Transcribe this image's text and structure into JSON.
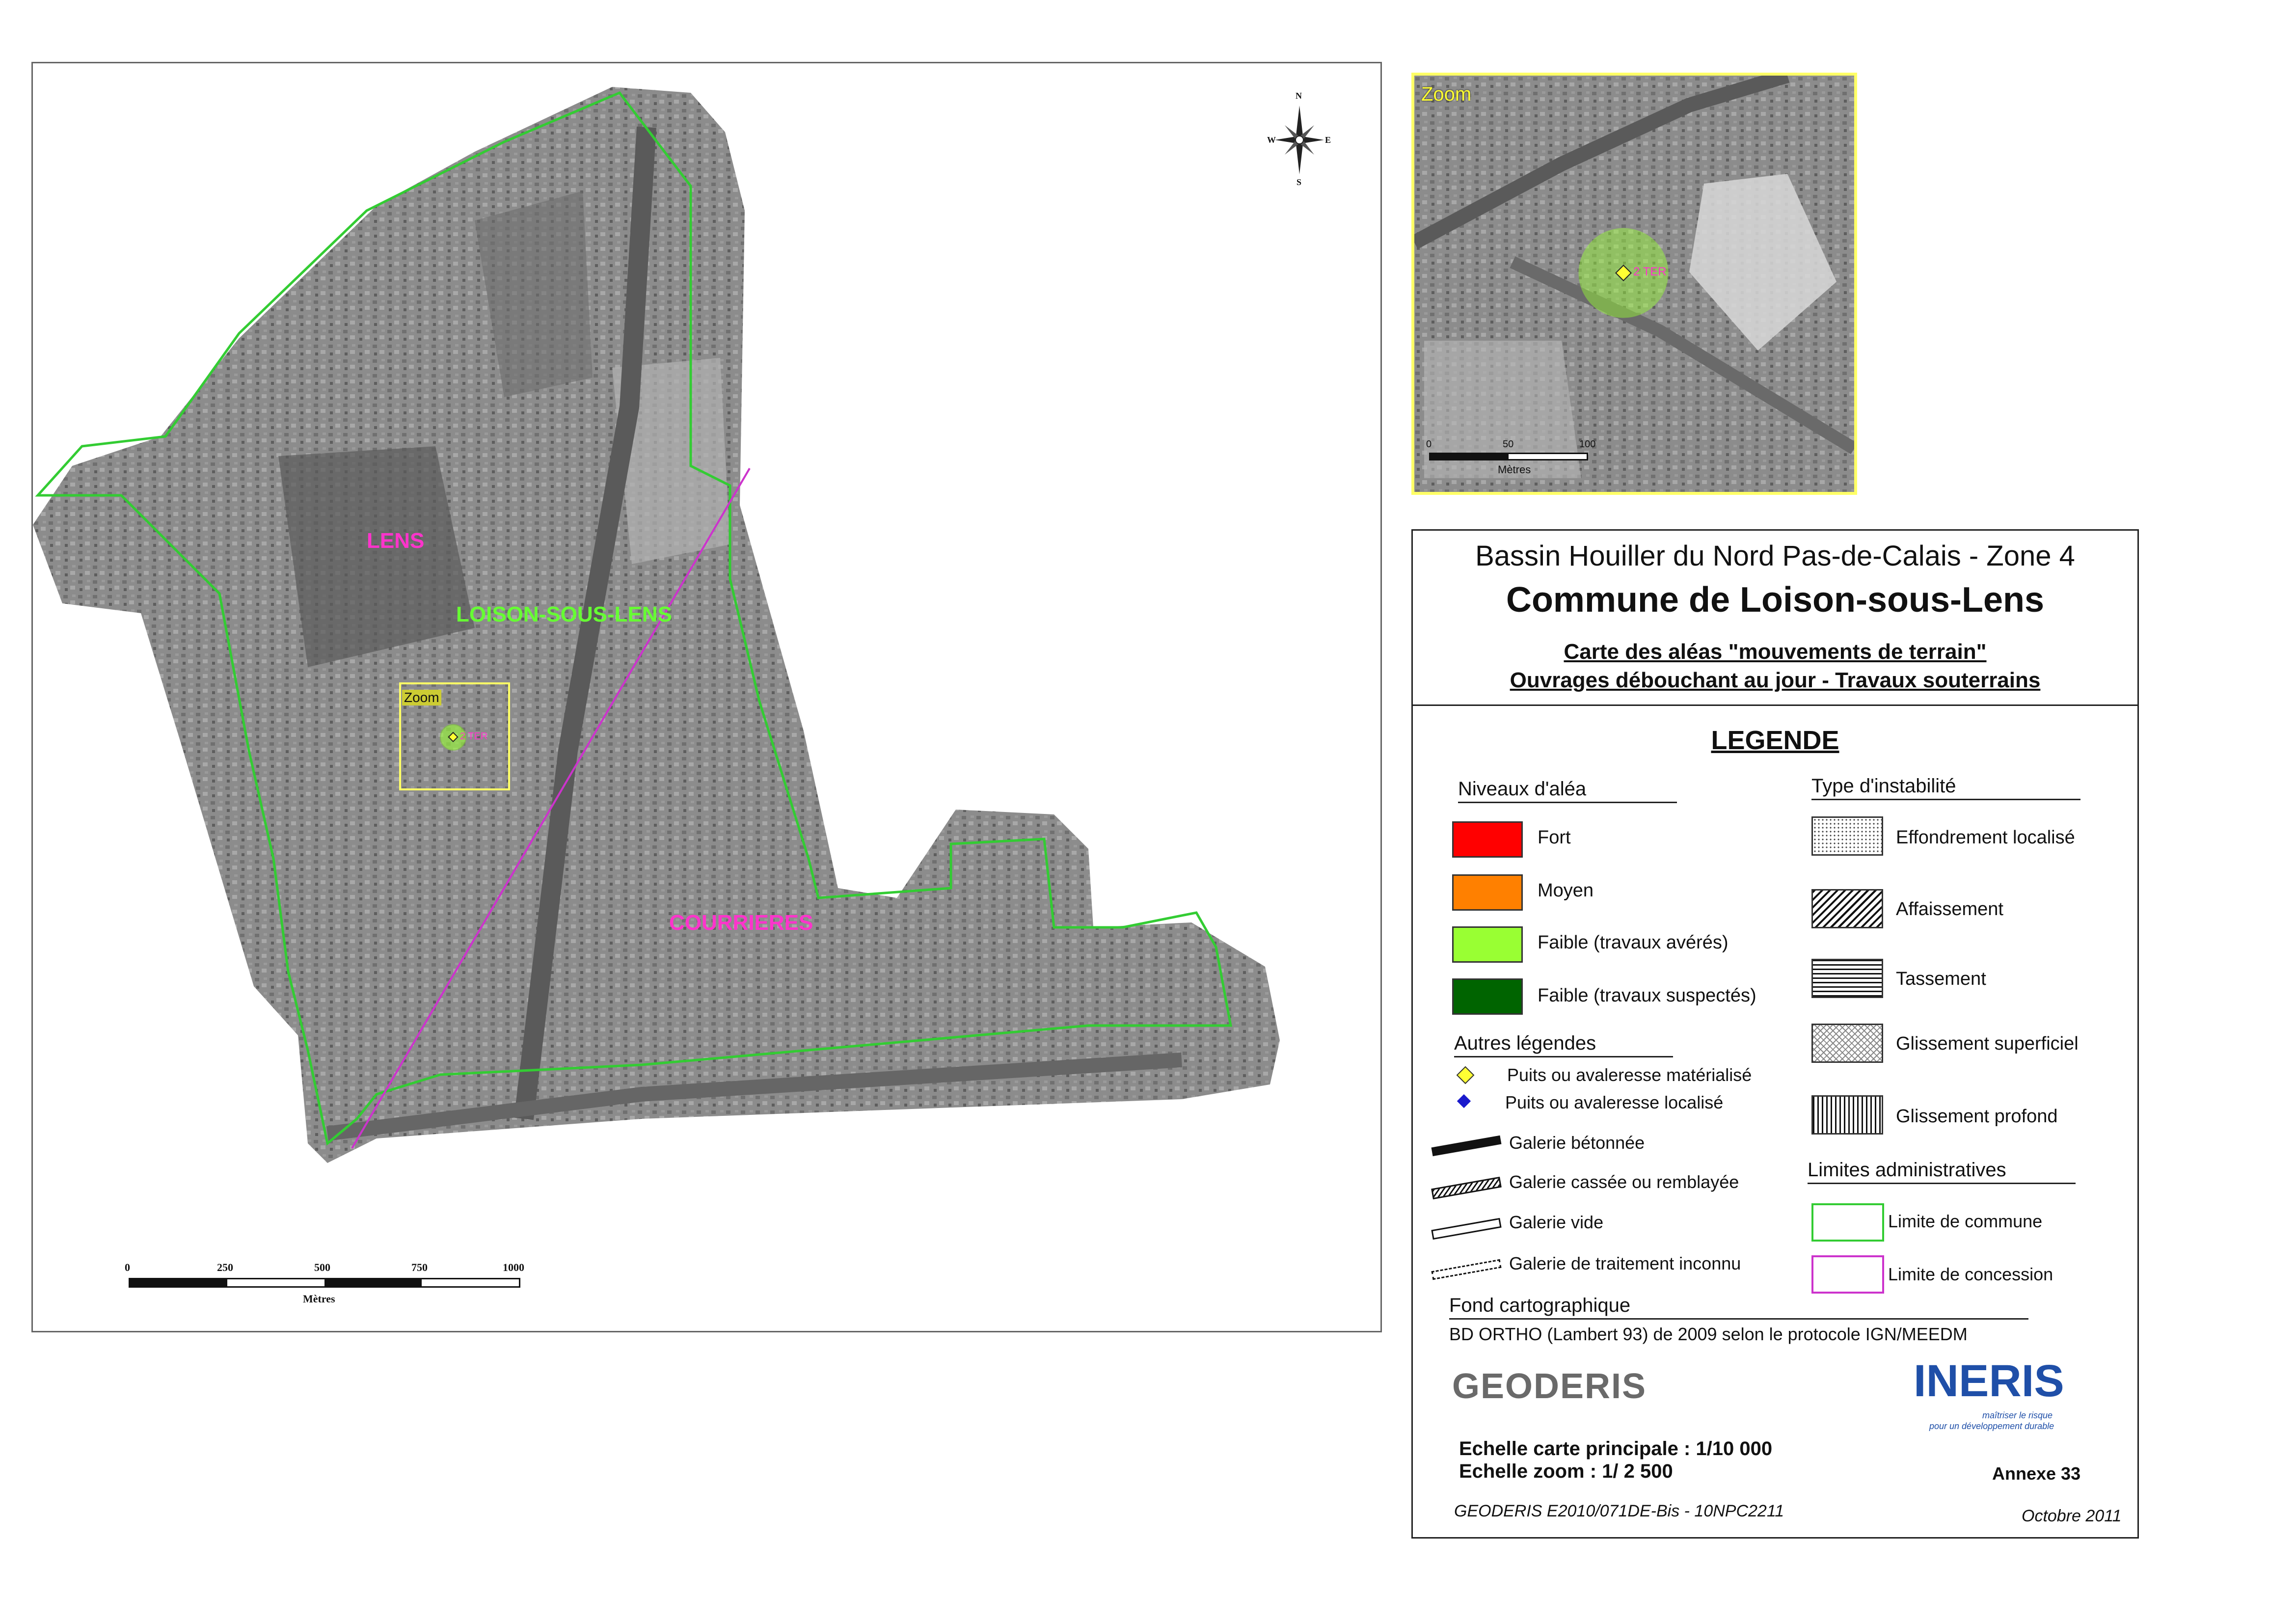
{
  "colors": {
    "commune_boundary": "#33cc33",
    "concession_boundary": "#cc33cc",
    "fort": "#ff0000",
    "moyen": "#ff8000",
    "faible_averes": "#99ff33",
    "faible_suspectes": "#006400",
    "zoom_frame": "#ffff66",
    "label_magenta": "#ff33cc",
    "label_green": "#66ff33"
  },
  "map": {
    "labels": {
      "lens": "LENS",
      "loison": "LOISON-SOUS-LENS",
      "courrieres": "COURRIERES",
      "zoom": "Zoom",
      "puits": "2 TER"
    },
    "north_arrow": {
      "n": "N",
      "s": "S",
      "e": "E",
      "w": "W"
    },
    "scale_bar": {
      "ticks": [
        "0",
        "250",
        "500",
        "750",
        "1000"
      ],
      "unit": "Mètres"
    }
  },
  "zoom_inset": {
    "title": "Zoom",
    "puits_label": "2 TER",
    "scale_bar": {
      "ticks": [
        "0",
        "50",
        "100"
      ],
      "unit": "Mètres"
    }
  },
  "title_block": {
    "line1": "Bassin Houiller du Nord Pas-de-Calais - Zone 4",
    "line2": "Commune de Loison-sous-Lens",
    "line3": "Carte des aléas \"mouvements de terrain\"",
    "line4": "Ouvrages débouchant au jour - Travaux souterrains"
  },
  "legend": {
    "title": "LEGENDE",
    "niveaux_heading": "Niveaux d'aléa",
    "niveaux": [
      {
        "label": "Fort",
        "color": "#ff0000"
      },
      {
        "label": "Moyen",
        "color": "#ff8000"
      },
      {
        "label": "Faible (travaux avérés)",
        "color": "#99ff33"
      },
      {
        "label": "Faible (travaux suspectés)",
        "color": "#006400"
      }
    ],
    "type_heading": "Type d'instabilité",
    "types": [
      "Effondrement  localisé",
      "Affaissement",
      "Tassement",
      "Glissement superficiel",
      "Glissement profond"
    ],
    "autres_heading": "Autres légendes",
    "autres": [
      "Puits ou avaleresse matérialisé",
      "Puits ou avaleresse localisé",
      "Galerie bétonnée",
      "Galerie cassée ou remblayée",
      "Galerie vide",
      "Galerie de traitement inconnu"
    ],
    "limites_heading": "Limites administratives",
    "limites": [
      "Limite de commune",
      "Limite de concession"
    ],
    "fond_heading": "Fond cartographique",
    "fond_text": "BD ORTHO (Lambert 93) de 2009 selon le protocole IGN/MEEDM",
    "logo_geoderis": "GEODERIS",
    "logo_ineris": "INERIS",
    "ineris_tagline1": "maîtriser le risque",
    "ineris_tagline2": "pour un développement durable",
    "echelle1": "Echelle carte principale : 1/10 000",
    "echelle2": "Echelle zoom : 1/ 2 500",
    "annexe": "Annexe 33",
    "reference": "GEODERIS E2010/071DE-Bis - 10NPC2211",
    "date": "Octobre 2011"
  }
}
